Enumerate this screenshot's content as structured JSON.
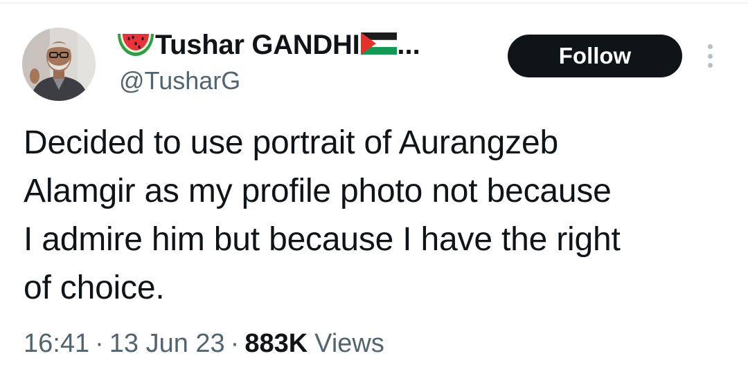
{
  "tweet": {
    "author": {
      "display_name": "Tushar GANDHI",
      "name_prefix_emoji": "watermelon-icon",
      "name_suffix_emoji": "palestine-flag-icon",
      "truncation": "...",
      "handle": "@TusharG"
    },
    "follow_label": "Follow",
    "more_icon": "more-vertical-icon",
    "text_lines": [
      "Decided to use portrait of Aurangzeb",
      "Alamgir as my profile photo not because",
      "I admire him but because I have the right",
      "of choice."
    ],
    "meta": {
      "time": "16:41",
      "separator": "·",
      "date": "13 Jun 23",
      "views_count": "883K",
      "views_label": "Views"
    }
  },
  "colors": {
    "text_primary": "#0f1419",
    "text_secondary": "#536471",
    "button_bg": "#0f1419",
    "button_text": "#ffffff"
  }
}
